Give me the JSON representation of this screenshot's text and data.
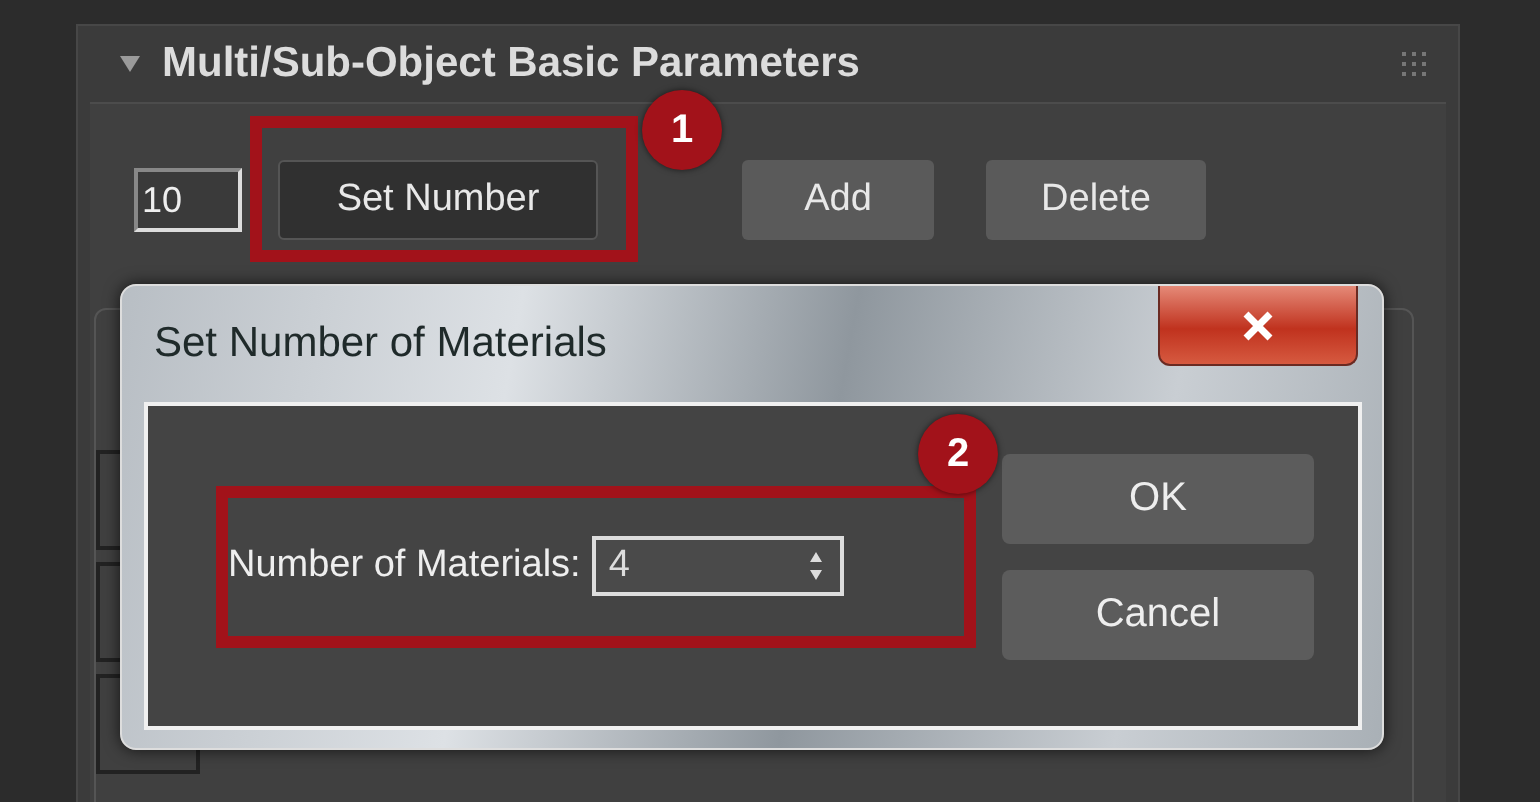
{
  "panel": {
    "title": "Multi/Sub-Object Basic Parameters",
    "expanded": true,
    "count_field": {
      "value": "10"
    },
    "callout": "1",
    "buttons": [
      {
        "label": "Set Number",
        "selected": true
      },
      {
        "label": "Add",
        "selected": false
      },
      {
        "label": "Delete",
        "selected": false
      }
    ]
  },
  "dialog": {
    "title": "Set Number of Materials",
    "callout": "2",
    "field": {
      "label": "Number of Materials:",
      "value": "4"
    },
    "buttons": [
      "OK",
      "Cancel"
    ]
  }
}
